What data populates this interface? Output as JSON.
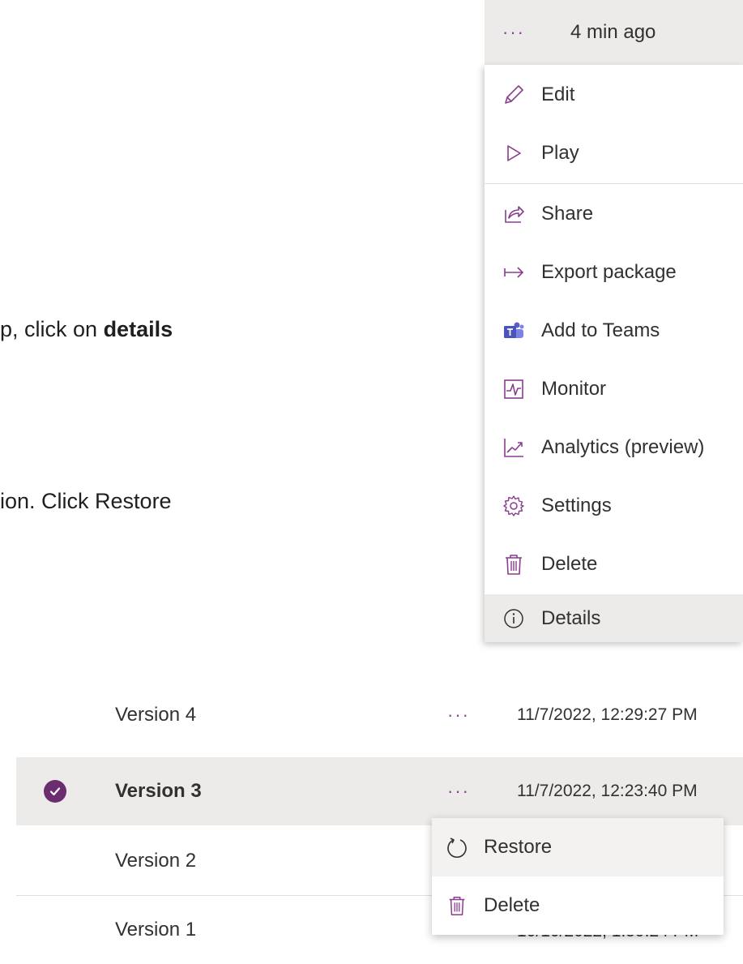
{
  "instructions": {
    "line1_prefix": "p, click on ",
    "line1_bold": "details",
    "line2": "ion. Click Restore"
  },
  "app_menu": {
    "more_label": "···",
    "modified": "4 min ago",
    "items": [
      {
        "label": "Edit",
        "icon": "pencil-icon"
      },
      {
        "label": "Play",
        "icon": "play-icon"
      },
      {
        "label": "Share",
        "icon": "share-icon"
      },
      {
        "label": "Export package",
        "icon": "export-arrow-icon"
      },
      {
        "label": "Add to Teams",
        "icon": "teams-icon"
      },
      {
        "label": "Monitor",
        "icon": "monitor-icon"
      },
      {
        "label": "Analytics (preview)",
        "icon": "analytics-icon"
      },
      {
        "label": "Settings",
        "icon": "gear-icon"
      },
      {
        "label": "Delete",
        "icon": "trash-icon"
      },
      {
        "label": "Details",
        "icon": "info-icon"
      }
    ]
  },
  "versions": {
    "more_label": "···",
    "rows": [
      {
        "name": "Version 4",
        "date": "11/7/2022, 12:29:27 PM",
        "selected": false
      },
      {
        "name": "Version 3",
        "date": "11/7/2022, 12:23:40 PM",
        "selected": true
      },
      {
        "name": "Version 2",
        "date": "",
        "selected": false
      },
      {
        "name": "Version 1",
        "date": "10/10/2022, 1:59:24 PM",
        "selected": false
      }
    ]
  },
  "context_menu": {
    "items": [
      {
        "label": "Restore",
        "icon": "restore-icon"
      },
      {
        "label": "Delete",
        "icon": "trash-icon"
      }
    ]
  },
  "colors": {
    "accent": "#8a3c8f",
    "selected_check": "#6b2d6f",
    "highlight": "#edebe9"
  }
}
